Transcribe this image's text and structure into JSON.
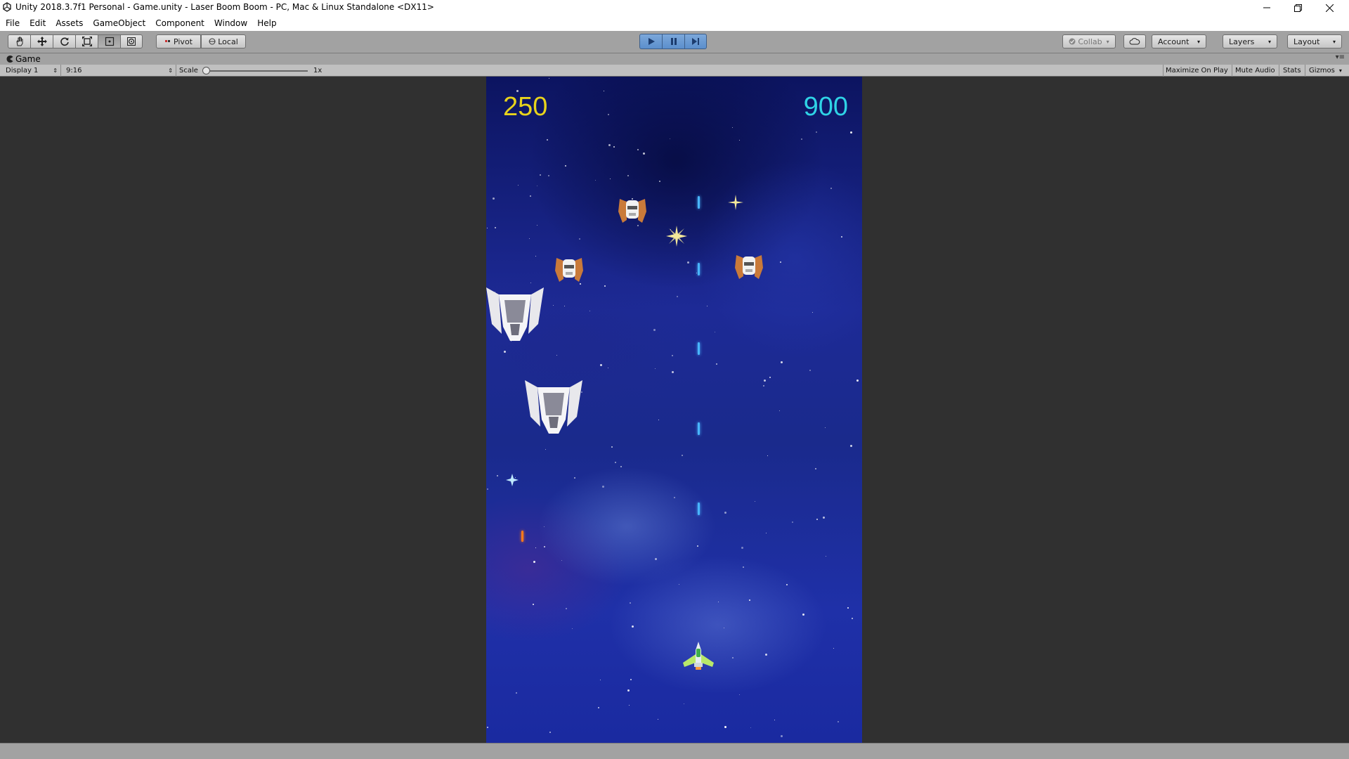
{
  "window": {
    "title": "Unity 2018.3.7f1 Personal - Game.unity - Laser Boom Boom - PC, Mac & Linux Standalone <DX11>"
  },
  "menu": {
    "items": [
      "File",
      "Edit",
      "Assets",
      "GameObject",
      "Component",
      "Window",
      "Help"
    ]
  },
  "toolbar": {
    "pivot_label": "Pivot",
    "local_label": "Local",
    "collab_label": "Collab",
    "account_label": "Account",
    "layers_label": "Layers",
    "layout_label": "Layout"
  },
  "game_view": {
    "tab_label": "Game",
    "display": "Display 1",
    "aspect": "9:16",
    "scale_label": "Scale",
    "scale_value": "1x",
    "scale_fraction": 0.0,
    "maximize_label": "Maximize On Play",
    "mute_label": "Mute Audio",
    "stats_label": "Stats",
    "gizmos_label": "Gizmos"
  },
  "game": {
    "score_left": "250",
    "score_right": "900",
    "score_left_color": "#e8d31c",
    "score_right_color": "#2fd3e6"
  },
  "colors": {
    "play_active": "#5b8fcc",
    "laser": "#49b6ff"
  }
}
